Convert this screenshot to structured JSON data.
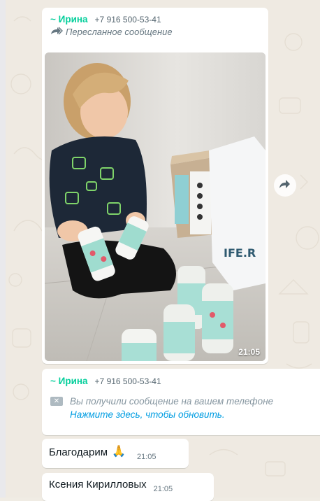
{
  "forwarded_message": {
    "sender_name": "~ Ирина",
    "sender_phone": "+7 916 500-53-41",
    "forwarded_label": "Пересланное сообщение",
    "photo_time": "21:05",
    "photo_box_text": "IFE.R"
  },
  "system_message": {
    "sender_name": "~ Ирина",
    "sender_phone": "+7 916 500-53-41",
    "notice_text": "Вы получили сообщение на вашем телефоне",
    "refresh_link": "Нажмите здесь, чтобы обновить."
  },
  "text_messages": [
    {
      "text": "Благодарим",
      "emoji": "🙏",
      "time": "21:05"
    },
    {
      "text": "Ксения Кирилловых",
      "time": "21:05"
    }
  ],
  "icons": {
    "forward_small": "forward-double-arrow-icon",
    "forward_button": "forward-arrow-icon",
    "notice_badge": "message-icon"
  },
  "colors": {
    "sender": "#06cf9c",
    "link": "#009de2",
    "wallpaper": "#efeae2",
    "bubble": "#ffffff"
  }
}
